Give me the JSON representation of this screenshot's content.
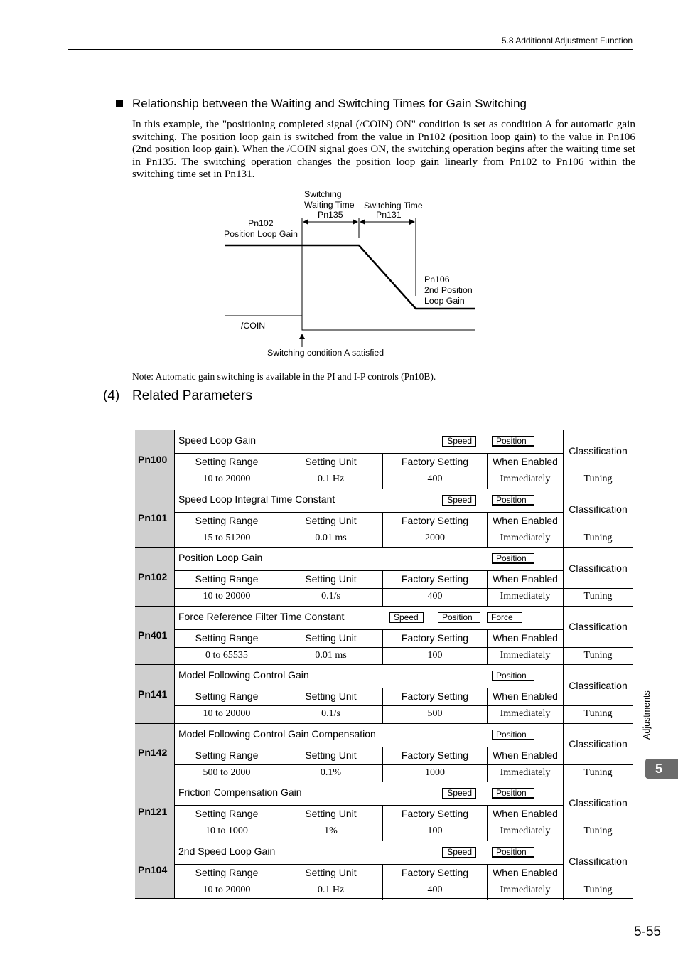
{
  "header": {
    "section": "5.8  Additional Adjustment Function"
  },
  "section": {
    "title": "Relationship between the Waiting and Switching Times for Gain Switching",
    "body": "In this example, the \"positioning completed signal (/COIN) ON\" condition is set as condition A for automatic gain switching. The position loop gain is switched from the value in Pn102 (position loop gain) to the value in Pn106 (2nd position loop gain). When the /COIN signal goes ON, the switching operation begins after the waiting time set in Pn135. The switching operation changes the position loop gain linearly from Pn102 to Pn106 within the switching time set in Pn131."
  },
  "diagram": {
    "labels": {
      "waiting_line1": "Switching",
      "waiting_line2": "Waiting Time",
      "waiting_line3": "Pn135",
      "switching_line1": "Switching Time",
      "switching_line2": "Pn131",
      "pn102_line1": "Pn102",
      "pn102_line2": "Position Loop Gain",
      "pn106_line1": "Pn106",
      "pn106_line2": "2nd Position",
      "pn106_line3": "Loop Gain",
      "coin": "/COIN",
      "condition": "Switching condition A satisfied"
    }
  },
  "note": "Note: Automatic gain switching is available in the PI and I-P controls (Pn10B).",
  "related": {
    "number": "(4)",
    "title": "Related Parameters"
  },
  "table_headers": {
    "range": "Setting Range",
    "unit": "Setting Unit",
    "factory": "Factory Setting",
    "enabled": "When Enabled",
    "classification": "Classification"
  },
  "parameters": [
    {
      "pn": "Pn100",
      "name": "Speed Loop Gain",
      "tags": [
        "Speed",
        "Position"
      ],
      "range": "10 to 20000",
      "unit": "0.1 Hz",
      "factory": "400",
      "enabled": "Immediately",
      "classification": "Tuning"
    },
    {
      "pn": "Pn101",
      "name": "Speed Loop Integral Time Constant",
      "tags": [
        "Speed",
        "Position"
      ],
      "range": "15 to 51200",
      "unit": "0.01 ms",
      "factory": "2000",
      "enabled": "Immediately",
      "classification": "Tuning"
    },
    {
      "pn": "Pn102",
      "name": "Position Loop Gain",
      "tags": [
        "Position"
      ],
      "range": "10 to 20000",
      "unit": "0.1/s",
      "factory": "400",
      "enabled": "Immediately",
      "classification": "Tuning"
    },
    {
      "pn": "Pn401",
      "name": "Force Reference Filter Time Constant",
      "tags": [
        "Speed",
        "Position",
        "Force"
      ],
      "range": "0 to 65535",
      "unit": "0.01 ms",
      "factory": "100",
      "enabled": "Immediately",
      "classification": "Tuning"
    },
    {
      "pn": "Pn141",
      "name": "Model Following Control Gain",
      "tags": [
        "Position"
      ],
      "range": "10 to 20000",
      "unit": "0.1/s",
      "factory": "500",
      "enabled": "Immediately",
      "classification": "Tuning"
    },
    {
      "pn": "Pn142",
      "name": "Model Following Control Gain Compensation",
      "tags": [
        "Position"
      ],
      "range": "500 to 2000",
      "unit": "0.1%",
      "factory": "1000",
      "enabled": "Immediately",
      "classification": "Tuning"
    },
    {
      "pn": "Pn121",
      "name": "Friction Compensation Gain",
      "tags": [
        "Speed",
        "Position"
      ],
      "range": "10 to 1000",
      "unit": "1%",
      "factory": "100",
      "enabled": "Immediately",
      "classification": "Tuning"
    },
    {
      "pn": "Pn104",
      "name": "2nd Speed Loop Gain",
      "tags": [
        "Speed",
        "Position"
      ],
      "range": "10 to 20000",
      "unit": "0.1 Hz",
      "factory": "400",
      "enabled": "Immediately",
      "classification": "Tuning"
    }
  ],
  "side": {
    "label": "Adjustments",
    "chapter": "5"
  },
  "footer": {
    "page": "5-55"
  }
}
